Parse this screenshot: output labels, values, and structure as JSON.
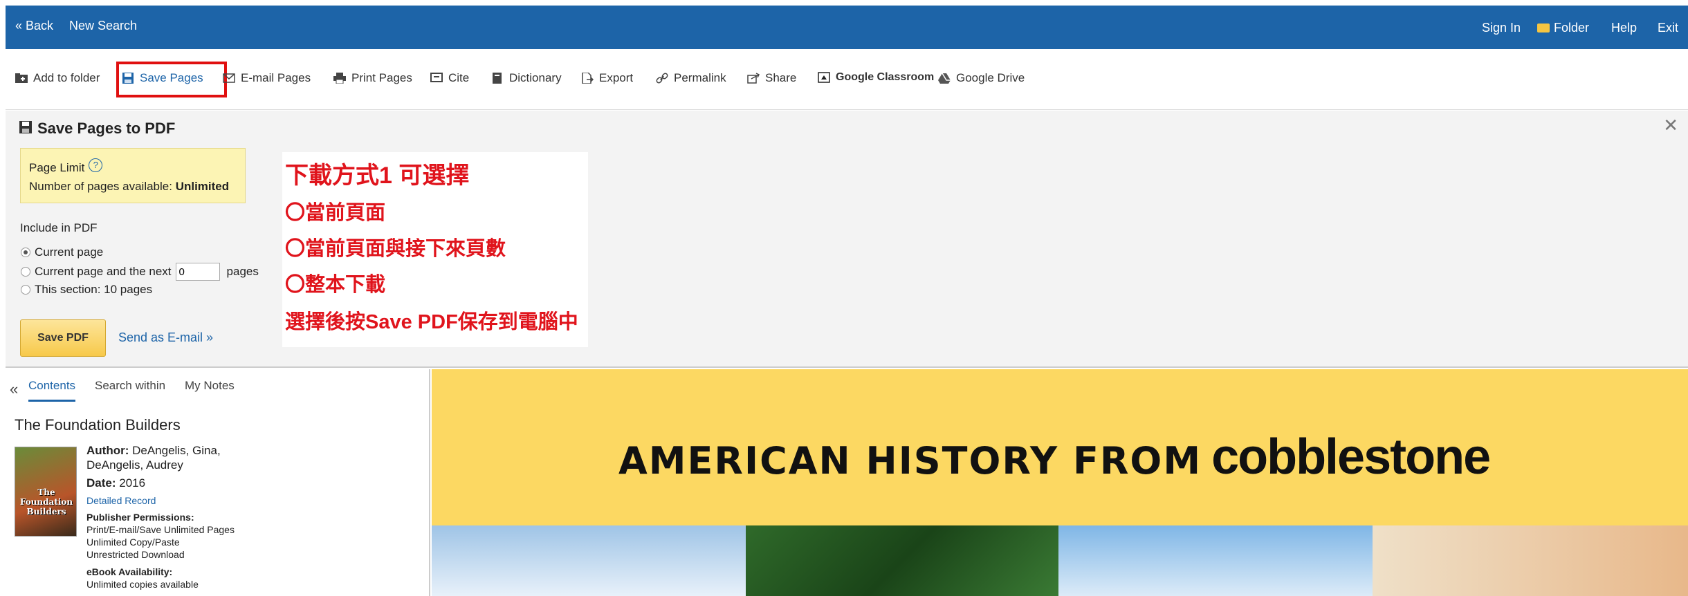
{
  "topbar": {
    "back": "« Back",
    "new_search": "New Search",
    "sign_in": "Sign In",
    "folder": "Folder",
    "help": "Help",
    "exit": "Exit"
  },
  "toolbar": {
    "add_to_folder": "Add to folder",
    "save_pages": "Save Pages",
    "email_pages": "E-mail Pages",
    "print_pages": "Print Pages",
    "cite": "Cite",
    "dictionary": "Dictionary",
    "export": "Export",
    "permalink": "Permalink",
    "share": "Share",
    "google_classroom": "Google Classroom",
    "google_drive": "Google Drive"
  },
  "panel": {
    "title": "Save Pages to PDF",
    "page_limit_label": "Page Limit",
    "pages_available_label": "Number of pages available:",
    "pages_available_value": "Unlimited",
    "include_label": "Include in PDF",
    "opt_current": "Current page",
    "opt_next_prefix": "Current page and the next",
    "opt_next_value": "0",
    "opt_next_suffix": "pages",
    "opt_section": "This section: 10 pages",
    "save_pdf": "Save PDF",
    "send_email": "Send as E-mail »"
  },
  "annotation": {
    "line1": "下載方式1 可選擇",
    "line2": "〇當前頁面",
    "line3": "〇當前頁面與接下來頁數",
    "line4": "〇整本下載",
    "line5": "選擇後按Save PDF保存到電腦中",
    "color": "#e0141c"
  },
  "sidebar": {
    "tabs": [
      "Contents",
      "Search within",
      "My Notes"
    ],
    "book_title": "The Foundation Builders",
    "cover_text": "The Foundation Builders",
    "author_label": "Author:",
    "author_value": "DeAngelis, Gina, DeAngelis, Audrey",
    "date_label": "Date:",
    "date_value": "2016",
    "detailed_record": "Detailed Record",
    "permissions_label": "Publisher Permissions:",
    "permissions_1": "Print/E-mail/Save Unlimited Pages",
    "permissions_2": "Unlimited Copy/Paste",
    "permissions_3": "Unrestricted Download",
    "availability_label": "eBook Availability:",
    "availability_value": "Unlimited copies available"
  },
  "viewer": {
    "banner_prefix": "AMERICAN HISTORY FROM",
    "banner_brand": "cobblestone"
  },
  "colors": {
    "topbar": "#1d64a8",
    "accent": "#1d64a8",
    "highlight_box": "#e01010",
    "banner": "#fcd862"
  }
}
